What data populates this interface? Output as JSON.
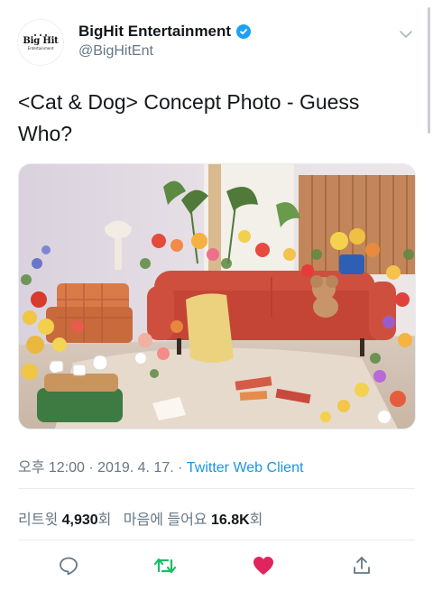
{
  "account": {
    "avatar_logo_text": "Big Hit",
    "avatar_logo_subtext": "Entertainment",
    "display_name": "BigHit Entertainment",
    "handle": "@BigHitEnt",
    "verified_icon": "verified-badge-icon",
    "menu_icon": "chevron-down-icon"
  },
  "tweet": {
    "text": "<Cat & Dog> Concept Photo - Guess Who?",
    "media_alt_icon": "photo"
  },
  "meta": {
    "time": "오후 12:00",
    "separator": " · ",
    "date": "2019. 4. 17.",
    "client": "Twitter Web Client",
    "client_color": "#1b95e0"
  },
  "stats": {
    "retweet_label": "리트윗",
    "retweet_count": "4,930",
    "retweet_suffix": "회",
    "like_label": "마음에 들어요",
    "like_count": "16.8K",
    "like_suffix": "회"
  },
  "actions": {
    "reply_icon": "reply-icon",
    "retweet_icon": "retweet-icon",
    "like_icon": "heart-icon",
    "share_icon": "share-icon",
    "retweet_color": "#17bf63",
    "like_color": "#e0245e"
  }
}
